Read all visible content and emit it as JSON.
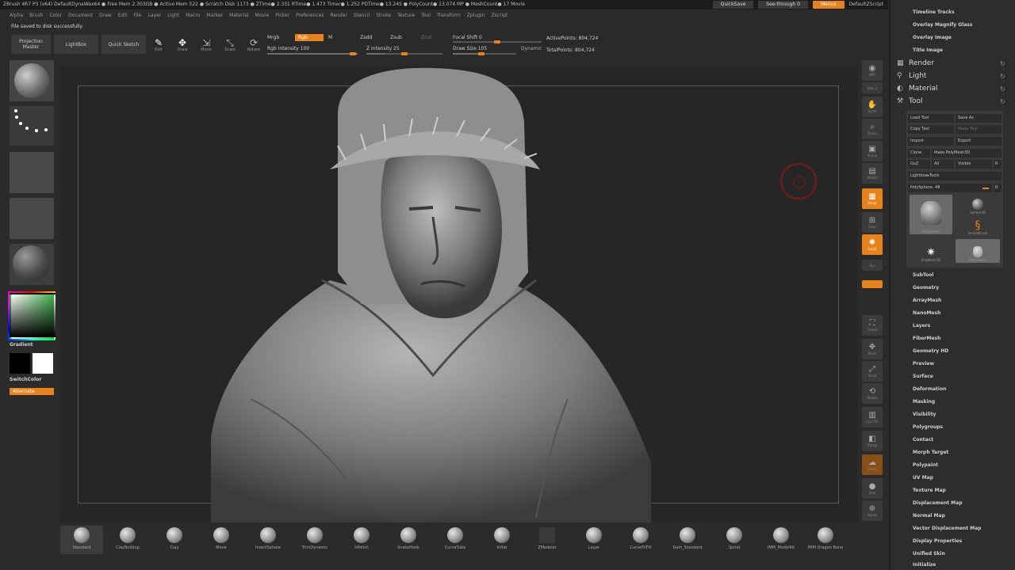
{
  "titlebar": {
    "text": "ZBrush 4R7 P3 (x64)    DefaultDynaWax64    ● Free Mem 2.303GB ● Active Mem 522 ● Scratch Disk 1173 ● ZTime● 2.331 RTime● 1.473 Timer● 1.252 PDTime● 13.245 ● PolyCount● 13.074 MP ● MeshCount● 17   Movie",
    "quicksave": "QuickSave",
    "see_through": "See-through  0",
    "menus": "Menus",
    "default_script": "DefaultZScript"
  },
  "menubar": [
    "Alpha",
    "Brush",
    "Color",
    "Document",
    "Draw",
    "Edit",
    "File",
    "Layer",
    "Light",
    "Macro",
    "Marker",
    "Material",
    "Movie",
    "Picker",
    "Preferences",
    "Render",
    "Stencil",
    "Stroke",
    "Texture",
    "Tool",
    "Transform",
    "Zplugin",
    "Zscript"
  ],
  "notification": "File saved to disk successfully.",
  "toolbar": {
    "projection_master": "Projection Master",
    "lightbox": "LightBox",
    "quick_sketch": "Quick Sketch",
    "edit": "Edit",
    "draw": "Draw",
    "move": "Move",
    "scale": "Scale",
    "rotate": "Rotate",
    "mrgb": "Mrgb",
    "rgb": "Rgb",
    "m": "M",
    "zadd": "Zadd",
    "zsub": "Zsub",
    "zcut": "Zcut",
    "rgb_intensity": "Rgb Intensity 100",
    "z_intensity": "Z Intensity 25",
    "focal_shift": "Focal Shift 0",
    "draw_size": "Draw Size 105",
    "dynamic": "Dynamic",
    "active_points": "ActivePoints: 804,724",
    "total_points": "TotalPoints: 804,724"
  },
  "leftshelf": {
    "gradient": "Gradient",
    "switch_color": "SwitchColor",
    "alternate": "Alternate",
    "colors": {
      "primary": "#000000",
      "secondary": "#ffffff",
      "accent": "#e8821c"
    }
  },
  "rightshelf": [
    {
      "icon": "bpr-icon",
      "label": "BPR"
    },
    {
      "icon": "spix-icon",
      "label": "SPix 3"
    },
    {
      "icon": "scroll-icon",
      "label": "Scroll"
    },
    {
      "icon": "zoom-icon",
      "label": "Zoom"
    },
    {
      "icon": "actual-icon",
      "label": "Actual"
    },
    {
      "icon": "aahalf-icon",
      "label": "AAHalf"
    },
    {
      "icon": "persp-icon",
      "label": "Persp"
    },
    {
      "icon": "floor-icon",
      "label": "Floor"
    },
    {
      "icon": "local-icon",
      "label": "Local"
    },
    {
      "icon": "xyz-icon",
      "label": "Xyz"
    },
    {
      "icon": "frame-icon",
      "label": "Frame"
    },
    {
      "icon": "move-icon",
      "label": "Move"
    },
    {
      "icon": "scale-icon",
      "label": "Scale"
    },
    {
      "icon": "rotate-icon",
      "label": "Rotate"
    },
    {
      "icon": "linefill-icon",
      "label": "Line Fill"
    },
    {
      "icon": "transp-icon",
      "label": "Transp"
    },
    {
      "icon": "ghost-icon",
      "label": "Ghost"
    },
    {
      "icon": "solo-icon",
      "label": "Solo"
    },
    {
      "icon": "xpose-icon",
      "label": "Xpose"
    }
  ],
  "tray": {
    "top_items": [
      "Timeline Tracks",
      "Overlay Magnify Glass",
      "Overlay Image",
      "Title Image"
    ],
    "headers": [
      "Render",
      "Light",
      "Material",
      "Tool"
    ],
    "tool_buttons": [
      "Load Tool",
      "Save As",
      "Copy Tool",
      "Paste Tool",
      "Import",
      "Export",
      "Clone",
      "Make PolyMesh3D",
      "GoZ",
      "All",
      "Visible",
      "R",
      "Lightbox▸Tools",
      "PolySphere. 48",
      "R"
    ],
    "tool_thumbs": [
      "PolySphere",
      "Sphere3D",
      "SimpleBrush",
      "PolyMesh3D",
      "PolySphere"
    ],
    "subpalettes": [
      "SubTool",
      "Geometry",
      "ArrayMesh",
      "NanoMesh",
      "Layers",
      "FiberMesh",
      "Geometry HD",
      "Preview",
      "Surface",
      "Deformation",
      "Masking",
      "Visibility",
      "Polygroups",
      "Contact",
      "Morph Target",
      "Polypaint",
      "UV Map",
      "Texture Map",
      "Displacement Map",
      "Normal Map",
      "Vector Displacement Map",
      "Display Properties",
      "Unified Skin",
      "Initialize"
    ]
  },
  "brushes": [
    "Standard",
    "ClayBuildup",
    "Clay",
    "Move",
    "InsertSphere",
    "TrimDynamic",
    "hPolish",
    "SnakeHook",
    "CurveTube",
    "Inflat",
    "ZModeler",
    "Layer",
    "CurveTriFill",
    "Dam_Standard",
    "Spiral",
    "IMM_ModelKit",
    "IMM Dragon Bone"
  ]
}
